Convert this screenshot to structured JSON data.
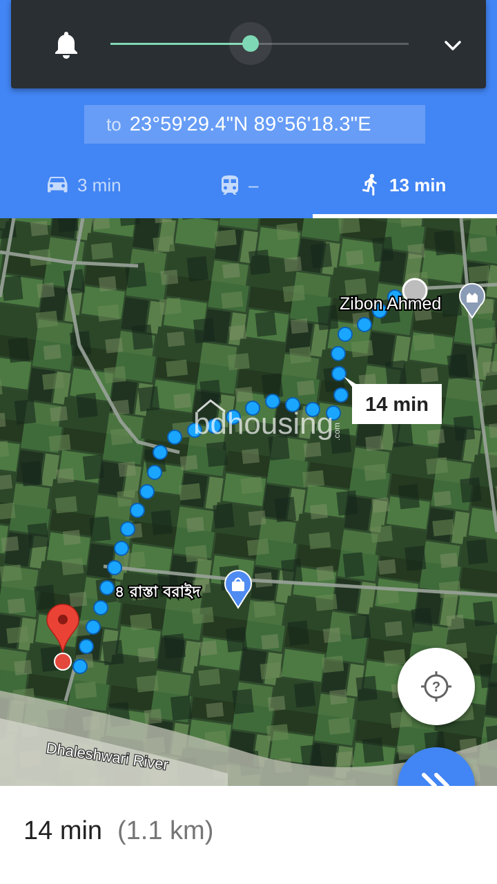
{
  "destination": {
    "prefix": "to",
    "coordinates": "23°59'29.4\"N 89°56'18.3\"E"
  },
  "volume": {
    "level": 0.47,
    "accent_color": "#7fd8b5"
  },
  "modes": {
    "drive": {
      "icon": "car-icon",
      "label": "3 min"
    },
    "transit": {
      "icon": "train-icon",
      "label": "–"
    },
    "walk": {
      "icon": "walking-icon",
      "label": "13 min",
      "selected": true
    }
  },
  "map": {
    "watermark": "bdhousing",
    "watermark_suffix": ".com",
    "route_duration_label": "14 min",
    "place_zibon": "Zibon Ahmed",
    "place_bangla": "৪ রাস্তা বরাইদ",
    "river": "Dhaleshwari River"
  },
  "summary": {
    "duration": "14 min",
    "distance": "(1.1 km)"
  },
  "colors": {
    "header": "#4285f4",
    "route": "#1aa6ff",
    "pin": "#ea4335"
  }
}
